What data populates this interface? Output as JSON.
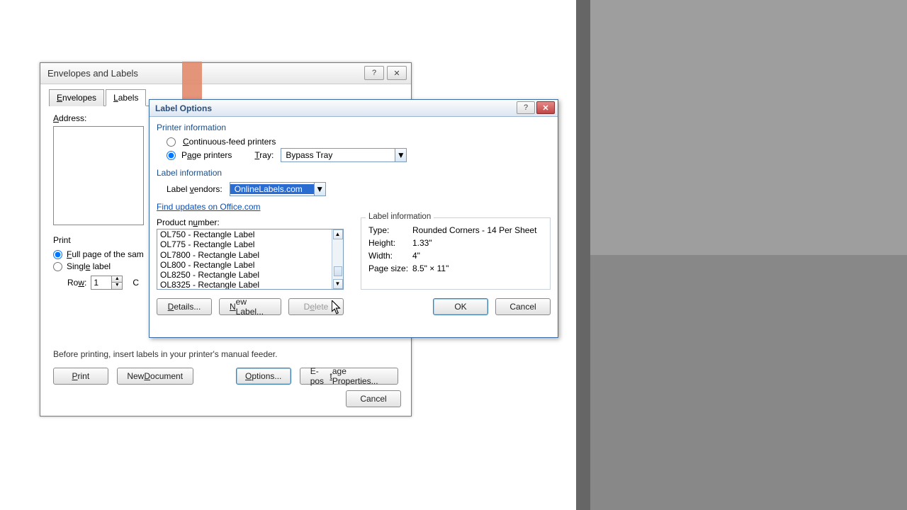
{
  "env_dialog": {
    "title": "Envelopes and Labels",
    "tabs": {
      "envelopes": "Envelopes",
      "labels": "Labels"
    },
    "address_label": "Address:",
    "print_group": "Print",
    "full_page": "Full page of the sam",
    "single": "Single label",
    "row_label": "Row:",
    "row_value": "1",
    "col_partial": "C",
    "help_text": "Before printing, insert labels in your printer's manual feeder.",
    "buttons": {
      "print": "Print",
      "new_doc": "New Document",
      "options": "Options...",
      "epost": "E-postage Properties...",
      "cancel": "Cancel"
    }
  },
  "opt_dialog": {
    "title": "Label Options",
    "printer_section": "Printer information",
    "cont_feed": "Continuous-feed printers",
    "page_printers": "Page printers",
    "tray_label": "Tray:",
    "tray_value": "Bypass Tray",
    "label_section": "Label information",
    "vendor_label": "Label vendors:",
    "vendor_value": "OnlineLabels.com",
    "find_updates": "Find updates on Office.com",
    "product_label": "Product number:",
    "products": [
      "OL750 - Rectangle Label",
      "OL775 - Rectangle Label",
      "OL7800 - Rectangle Label",
      "OL800 - Rectangle Label",
      "OL8250 - Rectangle Label",
      "OL8325 - Rectangle Label"
    ],
    "info_box_title": "Label information",
    "info": {
      "type_k": "Type:",
      "type_v": "Rounded Corners - 14 Per Sheet",
      "height_k": "Height:",
      "height_v": "1.33\"",
      "width_k": "Width:",
      "width_v": "4\"",
      "page_k": "Page size:",
      "page_v": "8.5\" × 11\""
    },
    "buttons": {
      "details": "Details...",
      "new_label": "New Label...",
      "delete": "Delete",
      "ok": "OK",
      "cancel": "Cancel"
    }
  }
}
